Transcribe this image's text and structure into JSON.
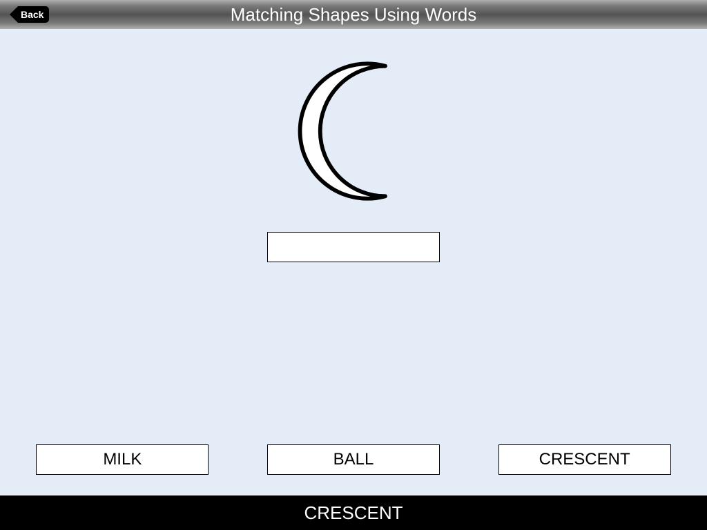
{
  "header": {
    "title": "Matching Shapes Using Words",
    "back_label": "Back"
  },
  "shape": {
    "name": "crescent"
  },
  "answer_slot": {
    "value": ""
  },
  "options": [
    {
      "label": "MILK"
    },
    {
      "label": "BALL"
    },
    {
      "label": "CRESCENT"
    }
  ],
  "footer": {
    "answer": "CRESCENT"
  }
}
